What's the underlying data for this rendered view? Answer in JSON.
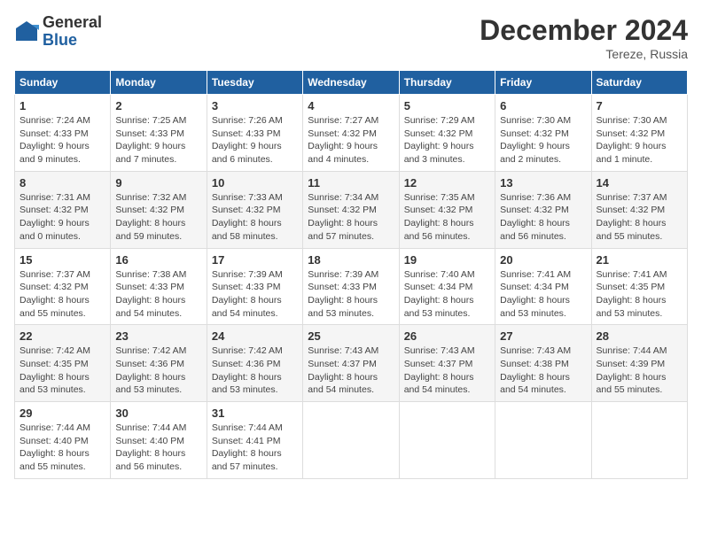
{
  "header": {
    "logo_general": "General",
    "logo_blue": "Blue",
    "month_title": "December 2024",
    "location": "Tereze, Russia"
  },
  "weekdays": [
    "Sunday",
    "Monday",
    "Tuesday",
    "Wednesday",
    "Thursday",
    "Friday",
    "Saturday"
  ],
  "weeks": [
    [
      {
        "day": "1",
        "info": "Sunrise: 7:24 AM\nSunset: 4:33 PM\nDaylight: 9 hours\nand 9 minutes."
      },
      {
        "day": "2",
        "info": "Sunrise: 7:25 AM\nSunset: 4:33 PM\nDaylight: 9 hours\nand 7 minutes."
      },
      {
        "day": "3",
        "info": "Sunrise: 7:26 AM\nSunset: 4:33 PM\nDaylight: 9 hours\nand 6 minutes."
      },
      {
        "day": "4",
        "info": "Sunrise: 7:27 AM\nSunset: 4:32 PM\nDaylight: 9 hours\nand 4 minutes."
      },
      {
        "day": "5",
        "info": "Sunrise: 7:29 AM\nSunset: 4:32 PM\nDaylight: 9 hours\nand 3 minutes."
      },
      {
        "day": "6",
        "info": "Sunrise: 7:30 AM\nSunset: 4:32 PM\nDaylight: 9 hours\nand 2 minutes."
      },
      {
        "day": "7",
        "info": "Sunrise: 7:30 AM\nSunset: 4:32 PM\nDaylight: 9 hours\nand 1 minute."
      }
    ],
    [
      {
        "day": "8",
        "info": "Sunrise: 7:31 AM\nSunset: 4:32 PM\nDaylight: 9 hours\nand 0 minutes."
      },
      {
        "day": "9",
        "info": "Sunrise: 7:32 AM\nSunset: 4:32 PM\nDaylight: 8 hours\nand 59 minutes."
      },
      {
        "day": "10",
        "info": "Sunrise: 7:33 AM\nSunset: 4:32 PM\nDaylight: 8 hours\nand 58 minutes."
      },
      {
        "day": "11",
        "info": "Sunrise: 7:34 AM\nSunset: 4:32 PM\nDaylight: 8 hours\nand 57 minutes."
      },
      {
        "day": "12",
        "info": "Sunrise: 7:35 AM\nSunset: 4:32 PM\nDaylight: 8 hours\nand 56 minutes."
      },
      {
        "day": "13",
        "info": "Sunrise: 7:36 AM\nSunset: 4:32 PM\nDaylight: 8 hours\nand 56 minutes."
      },
      {
        "day": "14",
        "info": "Sunrise: 7:37 AM\nSunset: 4:32 PM\nDaylight: 8 hours\nand 55 minutes."
      }
    ],
    [
      {
        "day": "15",
        "info": "Sunrise: 7:37 AM\nSunset: 4:32 PM\nDaylight: 8 hours\nand 55 minutes."
      },
      {
        "day": "16",
        "info": "Sunrise: 7:38 AM\nSunset: 4:33 PM\nDaylight: 8 hours\nand 54 minutes."
      },
      {
        "day": "17",
        "info": "Sunrise: 7:39 AM\nSunset: 4:33 PM\nDaylight: 8 hours\nand 54 minutes."
      },
      {
        "day": "18",
        "info": "Sunrise: 7:39 AM\nSunset: 4:33 PM\nDaylight: 8 hours\nand 53 minutes."
      },
      {
        "day": "19",
        "info": "Sunrise: 7:40 AM\nSunset: 4:34 PM\nDaylight: 8 hours\nand 53 minutes."
      },
      {
        "day": "20",
        "info": "Sunrise: 7:41 AM\nSunset: 4:34 PM\nDaylight: 8 hours\nand 53 minutes."
      },
      {
        "day": "21",
        "info": "Sunrise: 7:41 AM\nSunset: 4:35 PM\nDaylight: 8 hours\nand 53 minutes."
      }
    ],
    [
      {
        "day": "22",
        "info": "Sunrise: 7:42 AM\nSunset: 4:35 PM\nDaylight: 8 hours\nand 53 minutes."
      },
      {
        "day": "23",
        "info": "Sunrise: 7:42 AM\nSunset: 4:36 PM\nDaylight: 8 hours\nand 53 minutes."
      },
      {
        "day": "24",
        "info": "Sunrise: 7:42 AM\nSunset: 4:36 PM\nDaylight: 8 hours\nand 53 minutes."
      },
      {
        "day": "25",
        "info": "Sunrise: 7:43 AM\nSunset: 4:37 PM\nDaylight: 8 hours\nand 54 minutes."
      },
      {
        "day": "26",
        "info": "Sunrise: 7:43 AM\nSunset: 4:37 PM\nDaylight: 8 hours\nand 54 minutes."
      },
      {
        "day": "27",
        "info": "Sunrise: 7:43 AM\nSunset: 4:38 PM\nDaylight: 8 hours\nand 54 minutes."
      },
      {
        "day": "28",
        "info": "Sunrise: 7:44 AM\nSunset: 4:39 PM\nDaylight: 8 hours\nand 55 minutes."
      }
    ],
    [
      {
        "day": "29",
        "info": "Sunrise: 7:44 AM\nSunset: 4:40 PM\nDaylight: 8 hours\nand 55 minutes."
      },
      {
        "day": "30",
        "info": "Sunrise: 7:44 AM\nSunset: 4:40 PM\nDaylight: 8 hours\nand 56 minutes."
      },
      {
        "day": "31",
        "info": "Sunrise: 7:44 AM\nSunset: 4:41 PM\nDaylight: 8 hours\nand 57 minutes."
      },
      {
        "day": "",
        "info": ""
      },
      {
        "day": "",
        "info": ""
      },
      {
        "day": "",
        "info": ""
      },
      {
        "day": "",
        "info": ""
      }
    ]
  ]
}
